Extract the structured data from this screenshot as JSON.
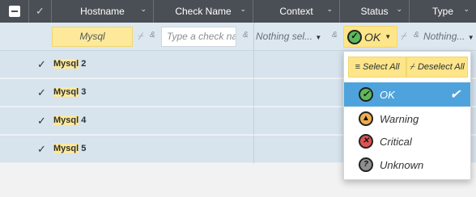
{
  "header": {
    "hostname": "Hostname",
    "check_name": "Check Name",
    "context": "Context",
    "status": "Status",
    "type": "Type"
  },
  "filters": {
    "hostname_value": "Mysql",
    "check_name_placeholder": "Type a check na",
    "context_value": "Nothing sel...",
    "status_value": "OK",
    "type_value": "Nothing...",
    "and_symbol": "&"
  },
  "rows": [
    {
      "host_match": "Mysql",
      "host_rest": " 2"
    },
    {
      "host_match": "Mysql",
      "host_rest": " 3"
    },
    {
      "host_match": "Mysql",
      "host_rest": " 4"
    },
    {
      "host_match": "Mysql",
      "host_rest": " 5"
    }
  ],
  "status_dropdown": {
    "select_all": "Select All",
    "deselect_all": "Deselect All",
    "options": [
      {
        "label": "OK",
        "icon": "ok-icon",
        "selected": true
      },
      {
        "label": "Warning",
        "icon": "warning-icon",
        "selected": false
      },
      {
        "label": "Critical",
        "icon": "critical-icon",
        "selected": false
      },
      {
        "label": "Unknown",
        "icon": "unknown-icon",
        "selected": false
      }
    ]
  },
  "colors": {
    "header_bg": "#4a4f55",
    "filter_bg": "#dce7f0",
    "highlight": "#fde99a",
    "selected_option": "#4fa3dc",
    "ok": "#5cb85c",
    "warning": "#f0ad4e",
    "critical": "#e05353",
    "unknown": "#8f8f8f"
  }
}
